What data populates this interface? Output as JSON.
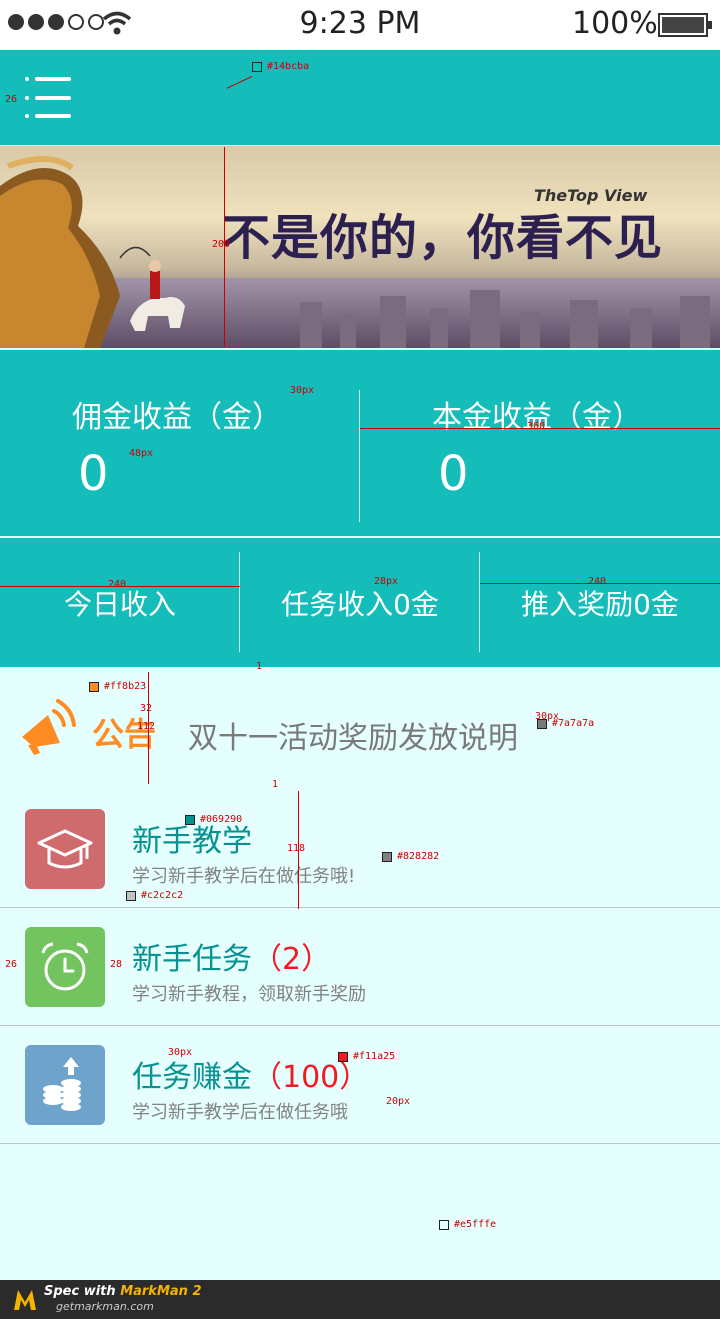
{
  "status_bar": {
    "time": "9:23 PM",
    "battery": "100%"
  },
  "banner": {
    "slogan": "不是你的，你看不见",
    "tagline": "TheTop View"
  },
  "stats": {
    "commission": {
      "label": "佣金收益（金）",
      "value": "0"
    },
    "principal": {
      "label": "本金收益（金）",
      "value": "0"
    }
  },
  "income": {
    "today": "今日收入",
    "task": "任务收入0金",
    "referral": "推入奖励0金"
  },
  "notice": {
    "title": "公告",
    "message": "双十一活动奖励发放说明"
  },
  "list": [
    {
      "title": "新手教学",
      "count": "",
      "subtitle": "学习新手教学后在做任务哦!",
      "icon": "graduation-cap-icon",
      "color": "#cf6a6d"
    },
    {
      "title": "新手任务",
      "count": "（2）",
      "subtitle": "学习新手教程，领取新手奖励",
      "icon": "alarm-clock-icon",
      "color": "#73c35f"
    },
    {
      "title": "任务赚金",
      "count": "（100）",
      "subtitle": "学习新手教学后在做任务哦",
      "icon": "coins-upload-icon",
      "color": "#6ea4cc"
    }
  ],
  "annotations": {
    "header_color": "#14bcba",
    "menu_offset": "26",
    "banner_height": "200",
    "label_size": "30px",
    "value_size": "48px",
    "half_width": "360",
    "income_size": "28px",
    "third_width_left": "240",
    "third_width_right": "240",
    "gap_1a": "1",
    "notice_color": "#ff8b23",
    "notice_height": "112",
    "notice_title_size": "32",
    "notice_msg_size": "30px",
    "notice_msg_color": "#7a7a7a",
    "gap_1b": "1",
    "title_color": "#069290",
    "sub_color": "#828282",
    "line_color": "#c2c2c2",
    "item_height": "118",
    "icon_left": "26",
    "icon_gap": "28",
    "title_size": "30px",
    "count_color": "#f11a25",
    "sub_size": "20px",
    "bg_color": "#e5fffe"
  },
  "footer": {
    "spec": "Spec with ",
    "brand": "MarkMan 2",
    "site": "getmarkman.com"
  }
}
